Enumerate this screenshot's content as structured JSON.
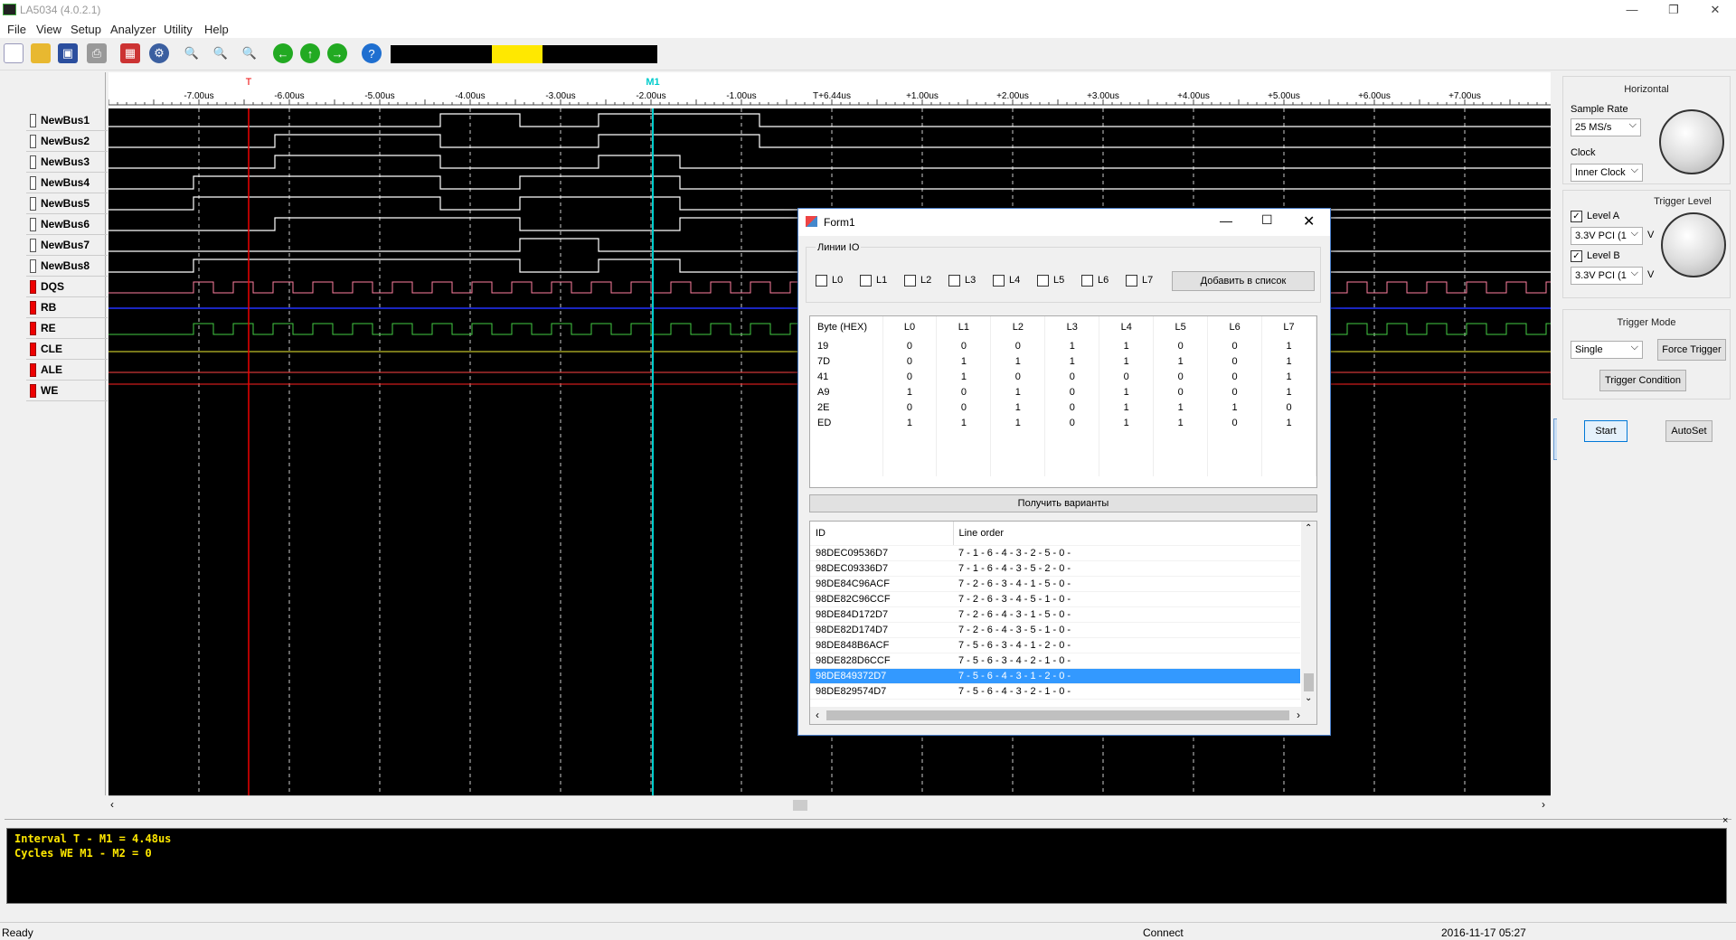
{
  "app": {
    "title": "LA5034 (4.0.2.1)"
  },
  "menu": [
    "File",
    "View",
    "Setup",
    "Analyzer",
    "Utility",
    "Help"
  ],
  "ruler": {
    "ticks": [
      "-7.00us",
      "-6.00us",
      "-5.00us",
      "-4.00us",
      "-3.00us",
      "-2.00us",
      "-1.00us",
      "T+6.44us",
      "+1.00us",
      "+2.00us",
      "+3.00us",
      "+4.00us",
      "+5.00us",
      "+6.00us",
      "+7.00us"
    ],
    "marker_t": "T",
    "marker_m1": "M1"
  },
  "channels": [
    {
      "name": "NewBus1",
      "red": false
    },
    {
      "name": "NewBus2",
      "red": false
    },
    {
      "name": "NewBus3",
      "red": false
    },
    {
      "name": "NewBus4",
      "red": false
    },
    {
      "name": "NewBus5",
      "red": false
    },
    {
      "name": "NewBus6",
      "red": false
    },
    {
      "name": "NewBus7",
      "red": false
    },
    {
      "name": "NewBus8",
      "red": false
    },
    {
      "name": "DQS",
      "red": true
    },
    {
      "name": "RB",
      "red": true
    },
    {
      "name": "RE",
      "red": true
    },
    {
      "name": "CLE",
      "red": true
    },
    {
      "name": "ALE",
      "red": true
    },
    {
      "name": "WE",
      "red": true
    }
  ],
  "right": {
    "horizontal": "Horizontal",
    "sample_rate_label": "Sample Rate",
    "sample_rate": "25 MS/s",
    "clock_label": "Clock",
    "clock": "Inner Clock",
    "trigger_level": "Trigger Level",
    "level_a": "Level A",
    "level_a_val": "3.3V PCI (1",
    "level_b": "Level B",
    "level_b_val": "3.3V PCI (1",
    "unit": "V",
    "trigger_mode": "Trigger Mode",
    "mode": "Single",
    "force_trigger": "Force Trigger",
    "trigger_condition": "Trigger Condition",
    "start": "Start",
    "autoset": "AutoSet"
  },
  "output": {
    "line1": "Interval  T - M1 = 4.48us",
    "line2": "Cycles  WE  M1 - M2 = 0"
  },
  "status": {
    "ready": "Ready",
    "connect": "Connect",
    "datetime": "2016-11-17  05:27"
  },
  "form": {
    "title": "Form1",
    "group": "Линии IO",
    "lines": [
      "L0",
      "L1",
      "L2",
      "L3",
      "L4",
      "L5",
      "L6",
      "L7"
    ],
    "add_button": "Добавить в список",
    "get_button": "Получить варианты",
    "byte_headers": [
      "Byte (HEX)",
      "L0",
      "L1",
      "L2",
      "L3",
      "L4",
      "L5",
      "L6",
      "L7"
    ],
    "bytes": [
      [
        "19",
        "0",
        "0",
        "0",
        "1",
        "1",
        "0",
        "0",
        "1"
      ],
      [
        "7D",
        "0",
        "1",
        "1",
        "1",
        "1",
        "1",
        "0",
        "1"
      ],
      [
        "41",
        "0",
        "1",
        "0",
        "0",
        "0",
        "0",
        "0",
        "1"
      ],
      [
        "A9",
        "1",
        "0",
        "1",
        "0",
        "1",
        "0",
        "0",
        "1"
      ],
      [
        "2E",
        "0",
        "0",
        "1",
        "0",
        "1",
        "1",
        "1",
        "0"
      ],
      [
        "ED",
        "1",
        "1",
        "1",
        "0",
        "1",
        "1",
        "0",
        "1"
      ]
    ],
    "id_headers": [
      "ID",
      "Line order"
    ],
    "ids": [
      [
        "98DEC09536D7",
        "7 - 1 - 6 - 4 - 3 - 2 - 5 - 0 -"
      ],
      [
        "98DEC09336D7",
        "7 - 1 - 6 - 4 - 3 - 5 - 2 - 0 -"
      ],
      [
        "98DE84C96ACF",
        "7 - 2 - 6 - 3 - 4 - 1 - 5 - 0 -"
      ],
      [
        "98DE82C96CCF",
        "7 - 2 - 6 - 3 - 4 - 5 - 1 - 0 -"
      ],
      [
        "98DE84D172D7",
        "7 - 2 - 6 - 4 - 3 - 1 - 5 - 0 -"
      ],
      [
        "98DE82D174D7",
        "7 - 2 - 6 - 4 - 3 - 5 - 1 - 0 -"
      ],
      [
        "98DE848B6ACF",
        "7 - 5 - 6 - 3 - 4 - 1 - 2 - 0 -"
      ],
      [
        "98DE828D6CCF",
        "7 - 5 - 6 - 3 - 4 - 2 - 1 - 0 -"
      ],
      [
        "98DE849372D7",
        "7 - 5 - 6 - 4 - 3 - 1 - 2 - 0 -"
      ],
      [
        "98DE829574D7",
        "7 - 5 - 6 - 4 - 3 - 2 - 1 - 0 -"
      ]
    ],
    "selected_index": 8
  }
}
